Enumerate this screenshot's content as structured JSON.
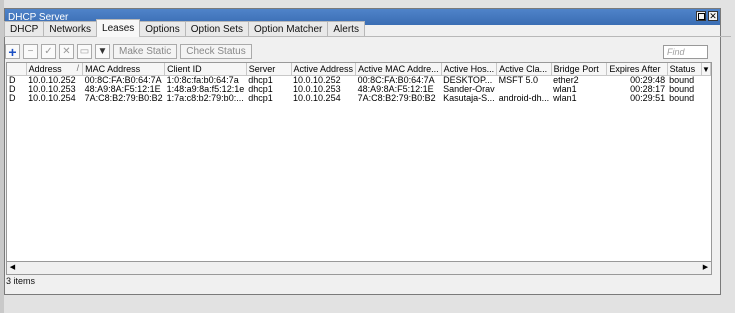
{
  "window": {
    "title": "DHCP Server"
  },
  "tabs": [
    {
      "label": "DHCP",
      "active": false
    },
    {
      "label": "Networks",
      "active": false
    },
    {
      "label": "Leases",
      "active": true
    },
    {
      "label": "Options",
      "active": false
    },
    {
      "label": "Option Sets",
      "active": false
    },
    {
      "label": "Option Matcher",
      "active": false
    },
    {
      "label": "Alerts",
      "active": false
    }
  ],
  "toolbar": {
    "make_static": "Make Static",
    "check_status": "Check Status",
    "find_placeholder": "Find"
  },
  "table": {
    "columns": [
      "",
      "Address",
      "MAC Address",
      "Client ID",
      "Server",
      "Active Address",
      "Active MAC Addre...",
      "Active Hos...",
      "Active Cla...",
      "Bridge Port",
      "Expires After",
      "Status",
      "▼"
    ],
    "rows": [
      [
        "D",
        "10.0.10.252",
        "00:8C:FA:B0:64:7A",
        "1:0:8c:fa:b0:64:7a",
        "dhcp1",
        "10.0.10.252",
        "00:8C:FA:B0:64:7A",
        "DESKTOP...",
        "MSFT 5.0",
        "ether2",
        "00:29:48",
        "bound",
        ""
      ],
      [
        "D",
        "10.0.10.253",
        "48:A9:8A:F5:12:1E",
        "1:48:a9:8a:f5:12:1e",
        "dhcp1",
        "10.0.10.253",
        "48:A9:8A:F5:12:1E",
        "Sander-Orav",
        "",
        "wlan1",
        "00:28:17",
        "bound",
        ""
      ],
      [
        "D",
        "10.0.10.254",
        "7A:C8:B2:79:B0:B2",
        "1:7a:c8:b2:79:b0:...",
        "dhcp1",
        "10.0.10.254",
        "7A:C8:B2:79:B0:B2",
        "Kasutaja-S...",
        "android-dh...",
        "wlan1",
        "00:29:51",
        "bound",
        ""
      ]
    ]
  },
  "status": {
    "item_count": "3 items"
  },
  "icons": [
    "add-icon",
    "remove-icon",
    "enable-icon",
    "disable-icon",
    "comment-icon",
    "filter-icon",
    "restore-window-icon",
    "close-icon",
    "sort-indicator-icon",
    "column-menu-icon",
    "scroll-left-icon",
    "scroll-right-icon"
  ]
}
